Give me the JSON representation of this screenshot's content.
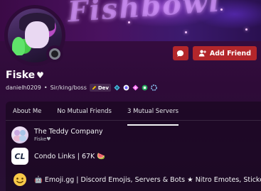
{
  "banner": {
    "text": "Fishbowl"
  },
  "profile": {
    "display_name": "Fiske",
    "name_emoji": "♥",
    "username": "danielh0209",
    "separator": "•",
    "pronouns": "Sir/king/boss",
    "dev_tag": "Dev"
  },
  "actions": {
    "add_friend_label": "Add Friend"
  },
  "tabs": [
    {
      "label": "About Me",
      "active": false
    },
    {
      "label": "No Mutual Friends",
      "active": false
    },
    {
      "label": "3 Mutual Servers",
      "active": true
    }
  ],
  "servers": [
    {
      "name": "The Teddy Company",
      "nickname": "Fiske♥",
      "icon": "teddy-server-icon"
    },
    {
      "name": "Condo Links | 67K 🍉",
      "nickname": "",
      "icon": "condo-links-server-icon",
      "icon_text": "CL"
    },
    {
      "name": "🤖 Emoji.gg | Discord Emojis, Servers & Bots ★ Nitro Emotes, Stickers...",
      "nickname": "",
      "icon": "emoji-gg-server-icon"
    }
  ],
  "colors": {
    "accent": "#b3262b",
    "background": "#2e0b38"
  }
}
